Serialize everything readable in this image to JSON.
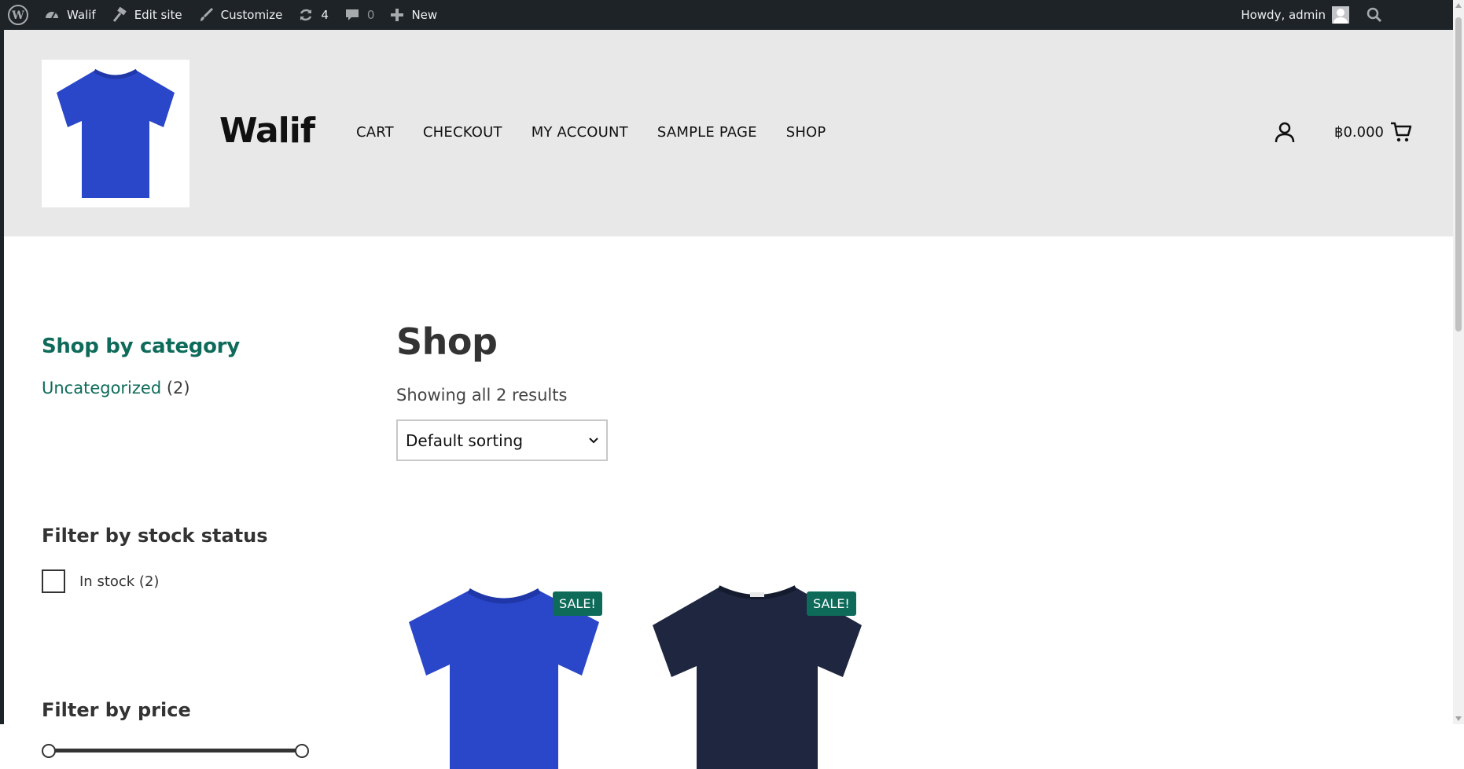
{
  "admin_bar": {
    "site_name": "Walif",
    "edit_site": "Edit site",
    "customize": "Customize",
    "updates_count": "4",
    "comments_count": "0",
    "new_label": "New",
    "greeting": "Howdy, admin"
  },
  "header": {
    "site_title": "Walif",
    "nav": [
      "CART",
      "CHECKOUT",
      "MY ACCOUNT",
      "SAMPLE PAGE",
      "SHOP"
    ],
    "cart_amount": "฿0.000"
  },
  "sidebar": {
    "category_title": "Shop by category",
    "category_name": "Uncategorized",
    "category_count": "(2)",
    "stock_title": "Filter by stock status",
    "stock_option": "In stock (2)",
    "price_title": "Filter by price",
    "price_range": [
      0,
      1
    ]
  },
  "main": {
    "title": "Shop",
    "result_count": "Showing all 2 results",
    "sorting": "Default sorting",
    "products": [
      {
        "sale_label": "SALE!",
        "image": "blue-tshirt",
        "color": "#2244c8"
      },
      {
        "sale_label": "SALE!",
        "image": "navy-tshirt",
        "color": "#1e2640"
      }
    ]
  },
  "colors": {
    "admin_bar": "#1d2327",
    "header_bg": "#e8e8e8",
    "accent_green": "#0e6b5a"
  }
}
